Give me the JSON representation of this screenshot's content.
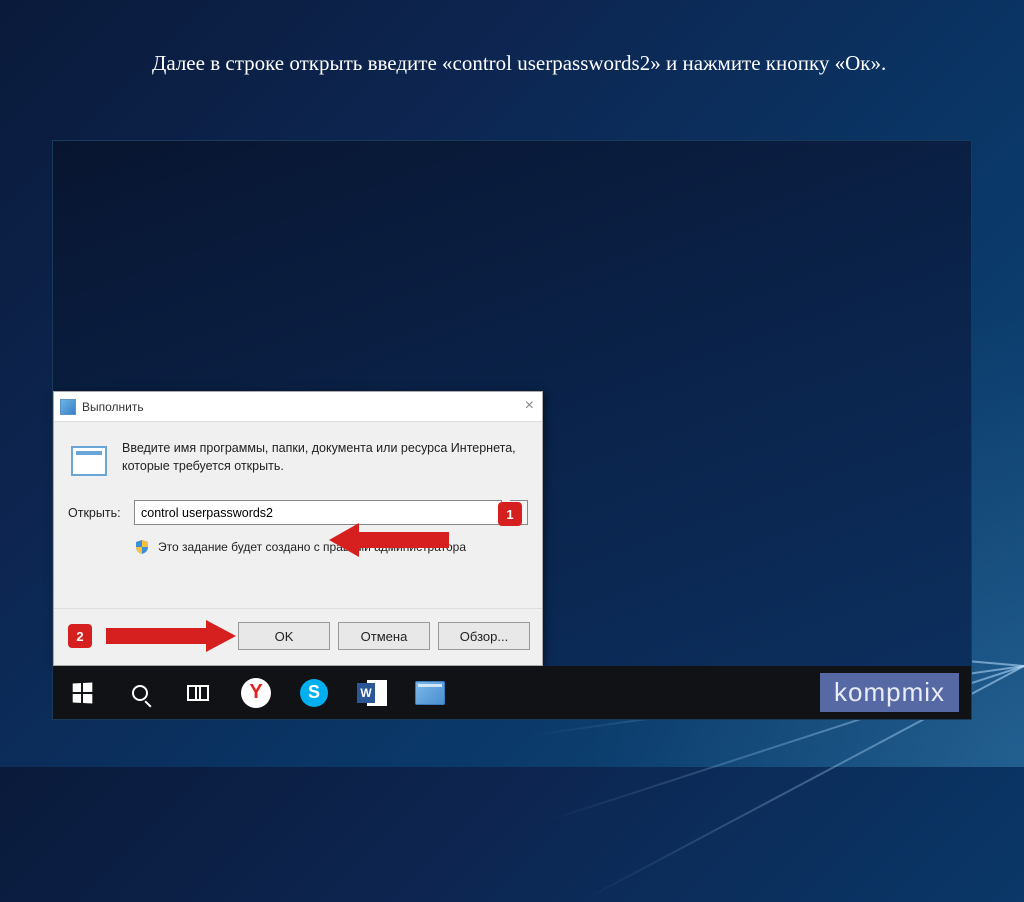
{
  "instruction": "Далее в строке открыть введите «control userpasswords2» и нажмите кнопку «Ок».",
  "dialog": {
    "title": "Выполнить",
    "description": "Введите имя программы, папки, документа или ресурса Интернета, которые требуется открыть.",
    "open_label": "Открыть:",
    "command_value": "control userpasswords2",
    "admin_note": "Это задание будет создано с правами администратора",
    "buttons": {
      "ok": "OK",
      "cancel": "Отмена",
      "browse": "Обзор..."
    },
    "close": "×"
  },
  "annotations": {
    "badge1": "1",
    "badge2": "2"
  },
  "taskbar": {
    "yandex_letter": "Y",
    "skype_letter": "S"
  },
  "watermark": "kompmix"
}
